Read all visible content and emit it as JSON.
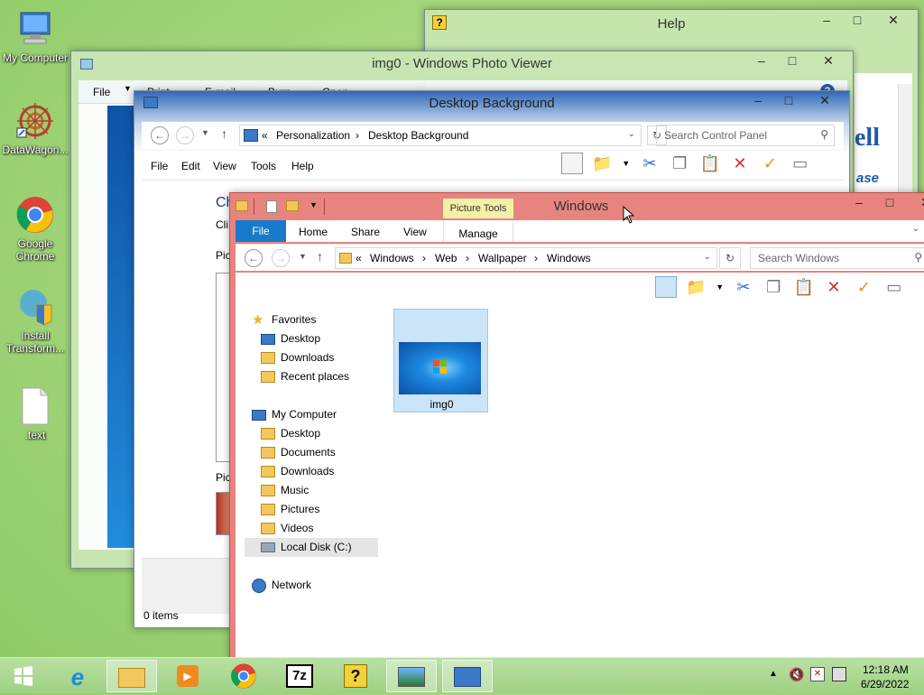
{
  "desktop": {
    "icons": [
      {
        "label": "My Computer"
      },
      {
        "label": "DataWagon..."
      },
      {
        "label": "Google Chrome"
      },
      {
        "label": "Install Transform..."
      },
      {
        "label": ".text"
      }
    ]
  },
  "help_window": {
    "title": "Help",
    "snippets": [
      "ell",
      "ase"
    ]
  },
  "photo_viewer": {
    "title": "img0 - Windows Photo Viewer",
    "menu": [
      "File",
      "Print",
      "E-mail",
      "Burn",
      "Open"
    ]
  },
  "desktop_bg": {
    "title": "Desktop Background",
    "breadcrumb": [
      "Personalization",
      "Desktop Background"
    ],
    "search_placeholder": "Search Control Panel",
    "menu": [
      "File",
      "Edit",
      "View",
      "Tools",
      "Help"
    ],
    "left_text": [
      "Ch",
      "Cli",
      "Pic",
      "Pic"
    ],
    "status": "0 items"
  },
  "explorer": {
    "title": "Windows",
    "context_tab": "Picture Tools",
    "ribbon_tabs": [
      "File",
      "Home",
      "Share",
      "View",
      "Manage"
    ],
    "breadcrumb": [
      "Windows",
      "Web",
      "Wallpaper",
      "Windows"
    ],
    "search_placeholder": "Search Windows",
    "nav": {
      "favorites_label": "Favorites",
      "favorites": [
        "Desktop",
        "Downloads",
        "Recent places"
      ],
      "computer_label": "My Computer",
      "computer": [
        "Desktop",
        "Documents",
        "Downloads",
        "Music",
        "Pictures",
        "Videos",
        "Local Disk (C:)"
      ],
      "network_label": "Network"
    },
    "files": [
      {
        "name": "img0"
      }
    ]
  },
  "taskbar": {
    "time": "12:18 AM",
    "date": "6/29/2022"
  },
  "colors": {
    "explorer_title": "#e8847e",
    "ribbon_file": "#1979ca",
    "picture_tools": "#f5f0a8",
    "selection": "#cce4f7"
  }
}
